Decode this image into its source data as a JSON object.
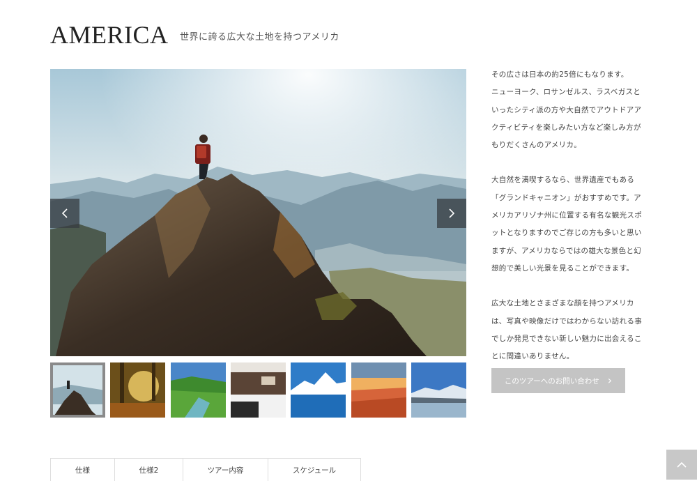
{
  "header": {
    "title": "AMERICA",
    "subtitle": "世界に誇る広大な土地を持つアメリカ"
  },
  "slider": {
    "prev_icon": "chevron-left-icon",
    "next_icon": "chevron-right-icon",
    "active_index": 0,
    "thumbnails": [
      {
        "name": "thumb-mountain-hiker"
      },
      {
        "name": "thumb-forest-sunlight"
      },
      {
        "name": "thumb-green-stream"
      },
      {
        "name": "thumb-hotel-room"
      },
      {
        "name": "thumb-snowy-mountain-lake"
      },
      {
        "name": "thumb-sunset-clouds"
      },
      {
        "name": "thumb-glacier"
      }
    ]
  },
  "description": {
    "paragraphs": [
      "その広さは日本の約25倍にもなります。\nニューヨーク、ロサンゼルス、ラスベガスといったシティ派の方や大自然でアウトドアアクティビティを楽しみたい方など楽しみ方がもりだくさんのアメリカ。",
      "大自然を満喫するなら、世界遺産でもある「グランドキャニオン」がおすすめです。アメリカアリゾナ州に位置する有名な観光スポットとなりますのでご存じの方も多いと思いますが、アメリカならではの雄大な景色と幻想的で美しい光景を見ることができます。",
      "広大な土地とさまざまな顔を持つアメリカは、写真や映像だけではわからない訪れる事でしか発見できない新しい魅力に出会えることに間違いありません。"
    ]
  },
  "contact_button": {
    "label": "このツアーへのお問い合わせ"
  },
  "tabs": [
    {
      "label": "仕様"
    },
    {
      "label": "仕様2"
    },
    {
      "label": "ツアー内容"
    },
    {
      "label": "スケジュール"
    }
  ],
  "back_to_top_icon": "chevron-up-icon"
}
